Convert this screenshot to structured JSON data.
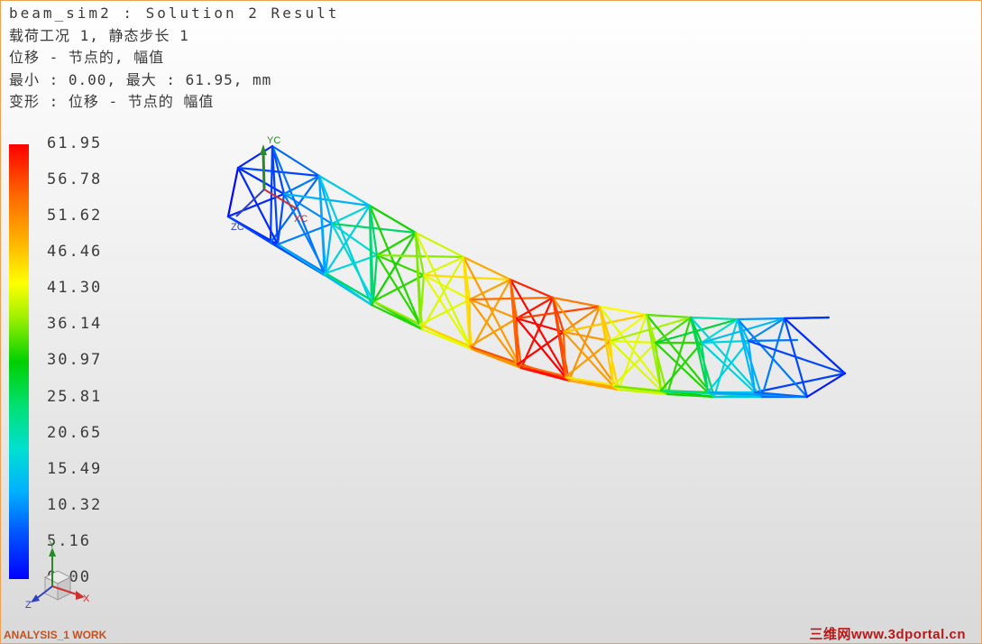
{
  "header": {
    "title": "beam_sim2 : Solution 2 Result",
    "load_case": "载荷工况 1, 静态步长 1",
    "result_type": "位移 - 节点的, 幅值",
    "min_max": "最小 : 0.00, 最大 : 61.95, mm",
    "deformation": "变形 : 位移 - 节点的 幅值"
  },
  "legend": {
    "ticks": [
      "61.95",
      "56.78",
      "51.62",
      "46.46",
      "41.30",
      "36.14",
      "30.97",
      "25.81",
      "20.65",
      "15.49",
      "10.32",
      "5.16",
      "0.00"
    ]
  },
  "triad_model": {
    "y_label": "YC",
    "x_label": "XC",
    "z_label": "ZC"
  },
  "triad_view": {
    "y_label": "Y",
    "x_label": "X",
    "z_label": "Z"
  },
  "status": {
    "work_label": "ANALYSIS_1 WORK"
  },
  "watermark": "三维网www.3dportal.cn",
  "colors": {
    "max": "#ff0000",
    "min": "#0000ff",
    "frame": "#f0a050"
  }
}
